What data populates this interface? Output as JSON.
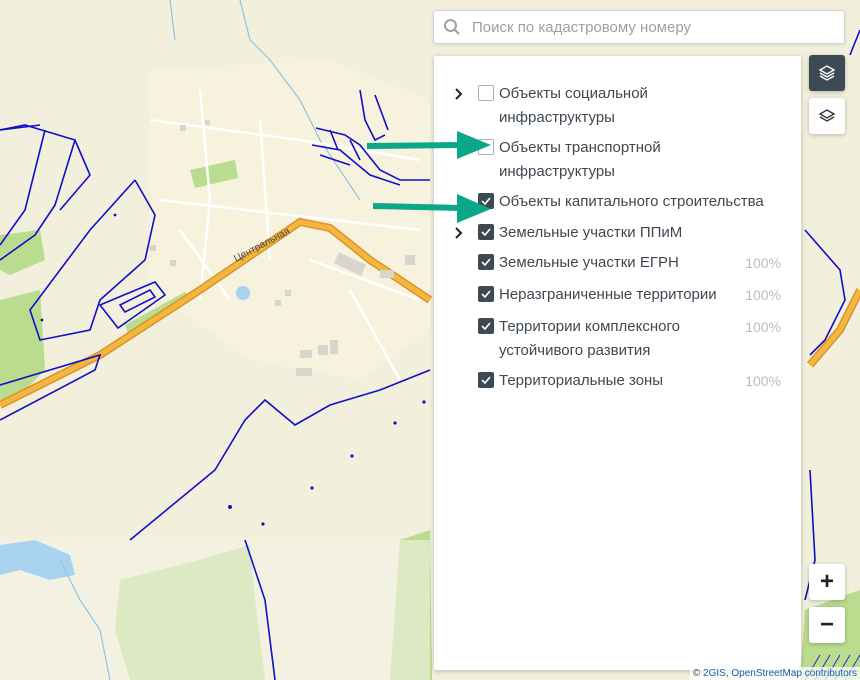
{
  "search": {
    "placeholder": "Поиск по кадастровому номеру"
  },
  "map": {
    "road_label": "Центральная"
  },
  "layers": [
    {
      "label": "Объекты социальной инфраструктуры",
      "checked": false,
      "expandable": true,
      "percent": ""
    },
    {
      "label": "Объекты транспортной инфраструктуры",
      "checked": false,
      "expandable": false,
      "percent": ""
    },
    {
      "label": "Объекты капитального строительства",
      "checked": true,
      "expandable": false,
      "percent": ""
    },
    {
      "label": "Земельные участки ППиМ",
      "checked": true,
      "expandable": true,
      "percent": ""
    },
    {
      "label": "Земельные участки ЕГРН",
      "checked": true,
      "expandable": false,
      "percent": "100%"
    },
    {
      "label": "Неразграниченные территории",
      "checked": true,
      "expandable": false,
      "percent": "100%"
    },
    {
      "label": "Территории комплексного устойчивого развития",
      "checked": true,
      "expandable": false,
      "percent": "100%"
    },
    {
      "label": "Территориальные зоны",
      "checked": true,
      "expandable": false,
      "percent": "100%"
    }
  ],
  "controls": {
    "zoom_in": "+",
    "zoom_out": "−"
  },
  "attribution": {
    "prefix": "© ",
    "provider1": "2GIS",
    "separator": ", ",
    "provider2": "OpenStreetMap contributors"
  },
  "colors": {
    "boundary": "#1010c8",
    "road": "#f2b13a",
    "green": "#b9dc8f",
    "water": "#a9d2ee",
    "arrow": "#0aa889",
    "panel_check": "#3d4a55"
  }
}
